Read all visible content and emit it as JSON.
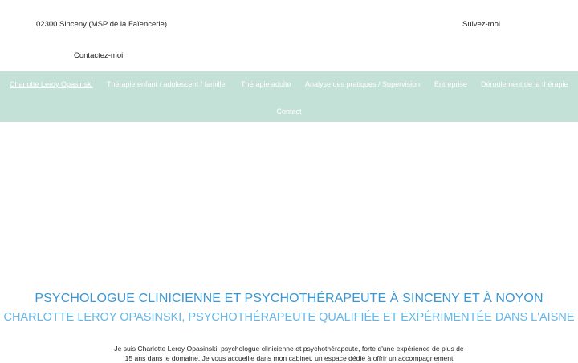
{
  "header": {
    "address": "02300 Sinceny (MSP de la Faïencerie)",
    "follow_label": "Suivez-moi",
    "contact_label": "Contactez-moi"
  },
  "nav": {
    "items": [
      {
        "label": "Charlotte Leroy Opasinski",
        "active": true
      },
      {
        "label": "Thérapie enfant / adolescent / famille"
      },
      {
        "label": "Thérapie adulte"
      },
      {
        "label": "Analyse des pratiques / Supervision"
      },
      {
        "label": "Entreprise"
      },
      {
        "label": "Déroulement de la thérapie"
      },
      {
        "label": "Contact"
      }
    ]
  },
  "main": {
    "title": "PSYCHOLOGUE CLINICIENNE ET PSYCHOTHÉRAPEUTE  À SINCENY ET À NOYON",
    "subtitle": "CHARLOTTE LEROY OPASINSKI, PSYCHOTHÉRAPEUTE QUALIFIÉE ET EXPÉRIMENTÉE DANS L'AISNE",
    "intro_line1": "Je suis Charlotte Leroy Opasinski, psychologue clinicienne et psychothérapeute, forte d'une expérience de plus de",
    "intro_line2": "15 ans dans le domaine. Je vous accueille dans mon cabinet, un espace dédié à offrir un accompagnement"
  },
  "colors": {
    "nav_bg": "#c4e1d8",
    "title": "#3a97d4",
    "subtitle": "#65b7e8"
  }
}
